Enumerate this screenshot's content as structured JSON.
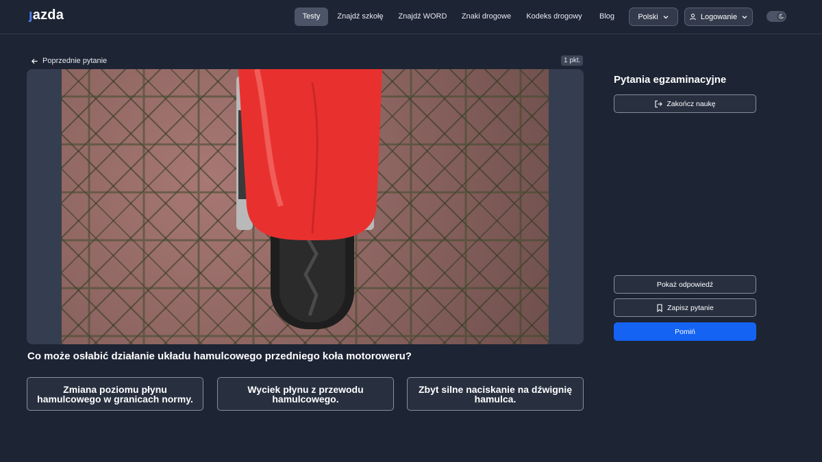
{
  "header": {
    "logo": "jazda",
    "nav": [
      {
        "label": "Testy",
        "active": true
      },
      {
        "label": "Znajdź szkołę",
        "active": false
      },
      {
        "label": "Znajdź WORD",
        "active": false
      },
      {
        "label": "Znaki drogowe",
        "active": false
      },
      {
        "label": "Kodeks drogowy",
        "active": false
      },
      {
        "label": "Blog",
        "active": false
      }
    ],
    "language": "Polski",
    "login": "Logowanie",
    "theme_icon": "moon-icon"
  },
  "main": {
    "back_label": "Poprzednie pytanie",
    "points": "1 pkt.",
    "image_description_icon": "motorcycle-front-wheel-photo",
    "question": "Co może osłabić działanie układu hamulcowego przedniego koła motoroweru?",
    "answers": [
      "Zmiana poziomu płynu hamulcowego w granicach normy.",
      "Wyciek płynu z przewodu hamulcowego.",
      "Zbyt silne naciskanie na dźwignię hamulca."
    ]
  },
  "sidebar": {
    "title": "Pytania egzaminacyjne",
    "finish_label": "Zakończ naukę",
    "show_answer_label": "Pokaż odpowiedź",
    "save_label": "Zapisz pytanie",
    "skip_label": "Pomiń"
  },
  "colors": {
    "background": "#1d2434",
    "panel": "#353e50",
    "accent": "#1463f3",
    "fender": "#e8312f"
  }
}
